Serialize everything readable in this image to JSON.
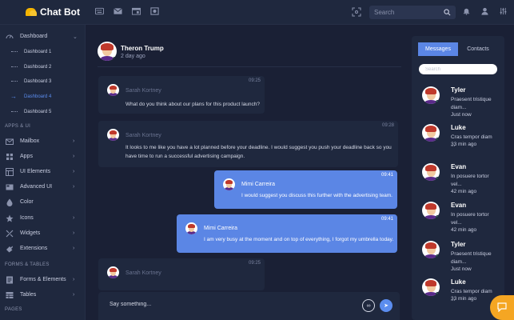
{
  "app": {
    "title": "Chat Bot",
    "brand_color": "#f4b400",
    "accent": "#5b86e5"
  },
  "topbar": {
    "icons": [
      "keyboard-icon",
      "mail-icon",
      "calendar-icon",
      "apps-icon"
    ],
    "search_placeholder": "Search",
    "right_icons": [
      "bell-icon",
      "user-icon",
      "settings-icon"
    ]
  },
  "sidebar": {
    "dashboard": {
      "label": "Dashboard"
    },
    "sub_items": [
      {
        "label": "Dashboard 1"
      },
      {
        "label": "Dashboard 2"
      },
      {
        "label": "Dashboard 3"
      },
      {
        "label": "Dashboard 4",
        "active": true
      },
      {
        "label": "Dashboard 5"
      }
    ],
    "sections": [
      "APPS & UI",
      "FORMS & TABLES",
      "PAGES"
    ],
    "apps_items": [
      {
        "label": "Mailbox",
        "icon": "mailbox-icon"
      },
      {
        "label": "Apps",
        "icon": "apps-icon"
      },
      {
        "label": "UI Elements",
        "icon": "elements-icon"
      },
      {
        "label": "Advanced UI",
        "icon": "advanced-icon"
      },
      {
        "label": "Color",
        "icon": "color-icon"
      },
      {
        "label": "Icons",
        "icon": "icons-icon"
      },
      {
        "label": "Widgets",
        "icon": "widgets-icon"
      },
      {
        "label": "Extensions",
        "icon": "extensions-icon"
      }
    ],
    "forms_items": [
      {
        "label": "Forms & Elements",
        "icon": "forms-icon"
      },
      {
        "label": "Tables",
        "icon": "tables-icon"
      }
    ]
  },
  "chat": {
    "header": {
      "name": "Theron Trump",
      "time": "2 day ago"
    },
    "messages": [
      {
        "name": "Sarah Kortney",
        "time": "09:25",
        "text": "What do you think about our plans for this product launch?"
      },
      {
        "name": "Sarah Kortney",
        "time": "09:28",
        "text_line1": "It looks to me like you have a lot planned before your deadline. I would suggest you push your deadline back so you",
        "text_line2": "have time to run a successful advertising campaign."
      },
      {
        "name": "Mimi Carreira",
        "time": "09:41",
        "text": "I would suggest you discuss this further with the advertising team."
      },
      {
        "name": "Mimi Carreira",
        "time": "09:41",
        "text": "I am very busy at the moment and on top of everything, I forgot my umbrella today."
      },
      {
        "name": "Sarah Kortney",
        "time": "09:25"
      }
    ],
    "compose_placeholder": "Say something...",
    "attach_glyph": "∞",
    "send_glyph": "➤"
  },
  "contacts_panel": {
    "tabs": [
      "Messages",
      "Contacts"
    ],
    "search_placeholder": "Search",
    "contacts": [
      {
        "name": "Tyler",
        "preview_line1": "Praesent tristique",
        "preview_line2": "diam...",
        "time": "Just now"
      },
      {
        "name": "Luke",
        "preview_line1": "Cras tempor diam ...",
        "preview_line2": "",
        "time": "33 min ago"
      },
      {
        "name": "Evan",
        "preview_line1": "In posuere tortor",
        "preview_line2": "vel...",
        "time": "42 min ago"
      },
      {
        "name": "Evan",
        "preview_line1": "In posuere tortor",
        "preview_line2": "vel...",
        "time": "42 min ago"
      },
      {
        "name": "Tyler",
        "preview_line1": "Praesent tristique",
        "preview_line2": "diam...",
        "time": "Just now"
      },
      {
        "name": "Luke",
        "preview_line1": "Cras tempor diam ...",
        "preview_line2": "",
        "time": "33 min ago"
      }
    ]
  },
  "chevron_glyph": "›",
  "chevron_down_glyph": "⌄",
  "active_arrow_glyph": "→"
}
